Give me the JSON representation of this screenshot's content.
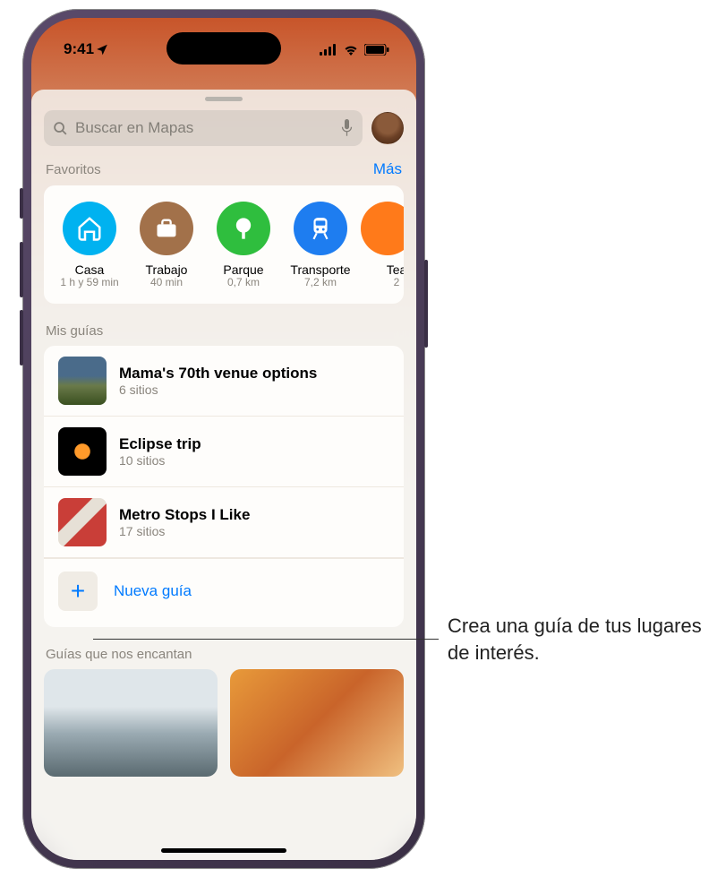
{
  "status": {
    "time": "9:41"
  },
  "search": {
    "placeholder": "Buscar en Mapas"
  },
  "favorites": {
    "title": "Favoritos",
    "more": "Más",
    "items": [
      {
        "label": "Casa",
        "sub": "1 h y 59 min",
        "color": "#00b2f0",
        "icon": "home"
      },
      {
        "label": "Trabajo",
        "sub": "40 min",
        "color": "#a2714a",
        "icon": "briefcase"
      },
      {
        "label": "Parque",
        "sub": "0,7 km",
        "color": "#2fbe3e",
        "icon": "tree"
      },
      {
        "label": "Transporte",
        "sub": "7,2 km",
        "color": "#1e7df0",
        "icon": "train"
      },
      {
        "label": "Tea",
        "sub": "2",
        "color": "#ff7a1a",
        "icon": "masks"
      }
    ]
  },
  "guides": {
    "title": "Mis guías",
    "items": [
      {
        "title": "Mama's 70th venue options",
        "sub": "6 sitios",
        "thumb_bg": "linear-gradient(180deg,#4a6b8a 0 40%,#6a7a4a 60%,#3a5020 100%)"
      },
      {
        "title": "Eclipse trip",
        "sub": "10 sitios",
        "thumb_bg": "radial-gradient(circle at 50% 50%, #ff9a2a 0 22%, #000 24% 100%)"
      },
      {
        "title": "Metro Stops I Like",
        "sub": "17 sitios",
        "thumb_bg": "linear-gradient(135deg,#c93e38 0 35%,#e6e0d6 36% 55%,#c93e38 56% 100%)"
      }
    ],
    "new_label": "Nueva guía"
  },
  "loved": {
    "title": "Guías que nos encantan"
  },
  "callout": {
    "text": "Crea una guía de tus lugares de interés."
  }
}
